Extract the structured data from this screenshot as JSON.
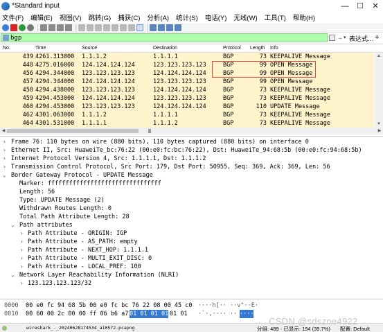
{
  "window": {
    "title": "*Standard input",
    "controls": [
      "—",
      "☐",
      "✕"
    ]
  },
  "menu": [
    "文件(F)",
    "编辑(E)",
    "视图(V)",
    "跳转(G)",
    "捕获(C)",
    "分析(A)",
    "统计(S)",
    "电话(Y)",
    "无线(W)",
    "工具(T)",
    "帮助(H)"
  ],
  "filter": {
    "value": "bgp",
    "arrow": "→",
    "dropdown": "▾",
    "expression_label": "表达式…",
    "plus": "+",
    "color": "#afffaf"
  },
  "packet_list": {
    "columns": [
      "No.",
      "Time",
      "Source",
      "Destination",
      "Protocol",
      "Length",
      "Info"
    ],
    "row_color": "#fff3cc",
    "rows": [
      {
        "no": "439",
        "time": "4261.313000",
        "src": "1.1.1.2",
        "dst": "1.1.1.1",
        "proto": "BGP",
        "len": "73",
        "info": "KEEPALIVE Message"
      },
      {
        "no": "448",
        "time": "4275.016000",
        "src": "124.124.124.124",
        "dst": "123.123.123.123",
        "proto": "BGP",
        "len": "99",
        "info": "OPEN Message"
      },
      {
        "no": "456",
        "time": "4294.344000",
        "src": "123.123.123.123",
        "dst": "124.124.124.124",
        "proto": "BGP",
        "len": "99",
        "info": "OPEN Message"
      },
      {
        "no": "457",
        "time": "4294.344000",
        "src": "124.124.124.124",
        "dst": "123.123.123.123",
        "proto": "BGP",
        "len": "99",
        "info": "OPEN Message"
      },
      {
        "no": "458",
        "time": "4294.438000",
        "src": "123.123.123.123",
        "dst": "124.124.124.124",
        "proto": "BGP",
        "len": "73",
        "info": "KEEPALIVE Message"
      },
      {
        "no": "459",
        "time": "4294.453000",
        "src": "124.124.124.124",
        "dst": "123.123.123.123",
        "proto": "BGP",
        "len": "73",
        "info": "KEEPALIVE Message"
      },
      {
        "no": "460",
        "time": "4294.453000",
        "src": "123.123.123.123",
        "dst": "124.124.124.124",
        "proto": "BGP",
        "len": "110",
        "info": "UPDATE Message"
      },
      {
        "no": "462",
        "time": "4301.063000",
        "src": "1.1.1.2",
        "dst": "1.1.1.1",
        "proto": "BGP",
        "len": "73",
        "info": "KEEPALIVE Message"
      },
      {
        "no": "464",
        "time": "4301.531000",
        "src": "1.1.1.1",
        "dst": "1.1.1.2",
        "proto": "BGP",
        "len": "73",
        "info": "KEEPALIVE Message"
      }
    ]
  },
  "details": [
    {
      "tw": "›",
      "text": "Frame 76: 110 bytes on wire (880 bits), 110 bytes captured (880 bits) on interface 0"
    },
    {
      "tw": "›",
      "text": "Ethernet II, Src: HuaweiTe_bc:76:22 (00:e0:fc:bc:76:22), Dst: HuaweiTe_94:68:5b (00:e0:fc:94:68:5b)"
    },
    {
      "tw": "›",
      "text": "Internet Protocol Version 4, Src: 1.1.1.1, Dst: 1.1.1.2"
    },
    {
      "tw": "›",
      "text": "Transmission Control Protocol, Src Port: 179, Dst Port: 50955, Seq: 369, Ack: 369, Len: 56"
    },
    {
      "tw": "⌄",
      "text": "Border Gateway Protocol - UPDATE Message"
    },
    {
      "tw": "",
      "text": "Marker: ffffffffffffffffffffffffffffffff"
    },
    {
      "tw": "",
      "text": "Length: 56"
    },
    {
      "tw": "",
      "text": "Type: UPDATE Message (2)"
    },
    {
      "tw": "",
      "text": "Withdrawn Routes Length: 0"
    },
    {
      "tw": "",
      "text": "Total Path Attribute Length: 28"
    },
    {
      "tw": "⌄",
      "text": "Path attributes"
    },
    {
      "tw": "›",
      "text": "Path Attribute - ORIGIN: IGP"
    },
    {
      "tw": "›",
      "text": "Path Attribute - AS_PATH: empty"
    },
    {
      "tw": "›",
      "text": "Path Attribute - NEXT_HOP: 1.1.1.1"
    },
    {
      "tw": "›",
      "text": "Path Attribute - MULTI_EXIT_DISC: 0"
    },
    {
      "tw": "›",
      "text": "Path Attribute - LOCAL_PREF: 100"
    },
    {
      "tw": "⌄",
      "text": "Network Layer Reachability Information (NLRI)"
    },
    {
      "tw": "›",
      "text": "123.123.123.123/32"
    }
  ],
  "bytes": [
    {
      "offset": "0000",
      "hex": "00 e0 fc 94 68 5b 00 e0  fc bc 76 22 08 00 45 c0",
      "hex_sel": "",
      "hex_rest": "",
      "ascii": "····h[·· ··v\"··E·",
      "ascii_sel": ""
    },
    {
      "offset": "0010",
      "hex": "00 60 00 2c 00 00 ff 06  b6 a7",
      "hex_sel": "01 01 01 01",
      "hex_rest": "01 01",
      "ascii": "·`·,···· ··",
      "ascii_sel": "····"
    }
  ],
  "status": {
    "file": "wireshark_-_20240628174534_a10572.pcapng",
    "stats": "分组: 489 · 已显示: 194 (39.7%)",
    "profile": "配置: Default"
  },
  "watermark": "CSDN @sdszoe4922"
}
